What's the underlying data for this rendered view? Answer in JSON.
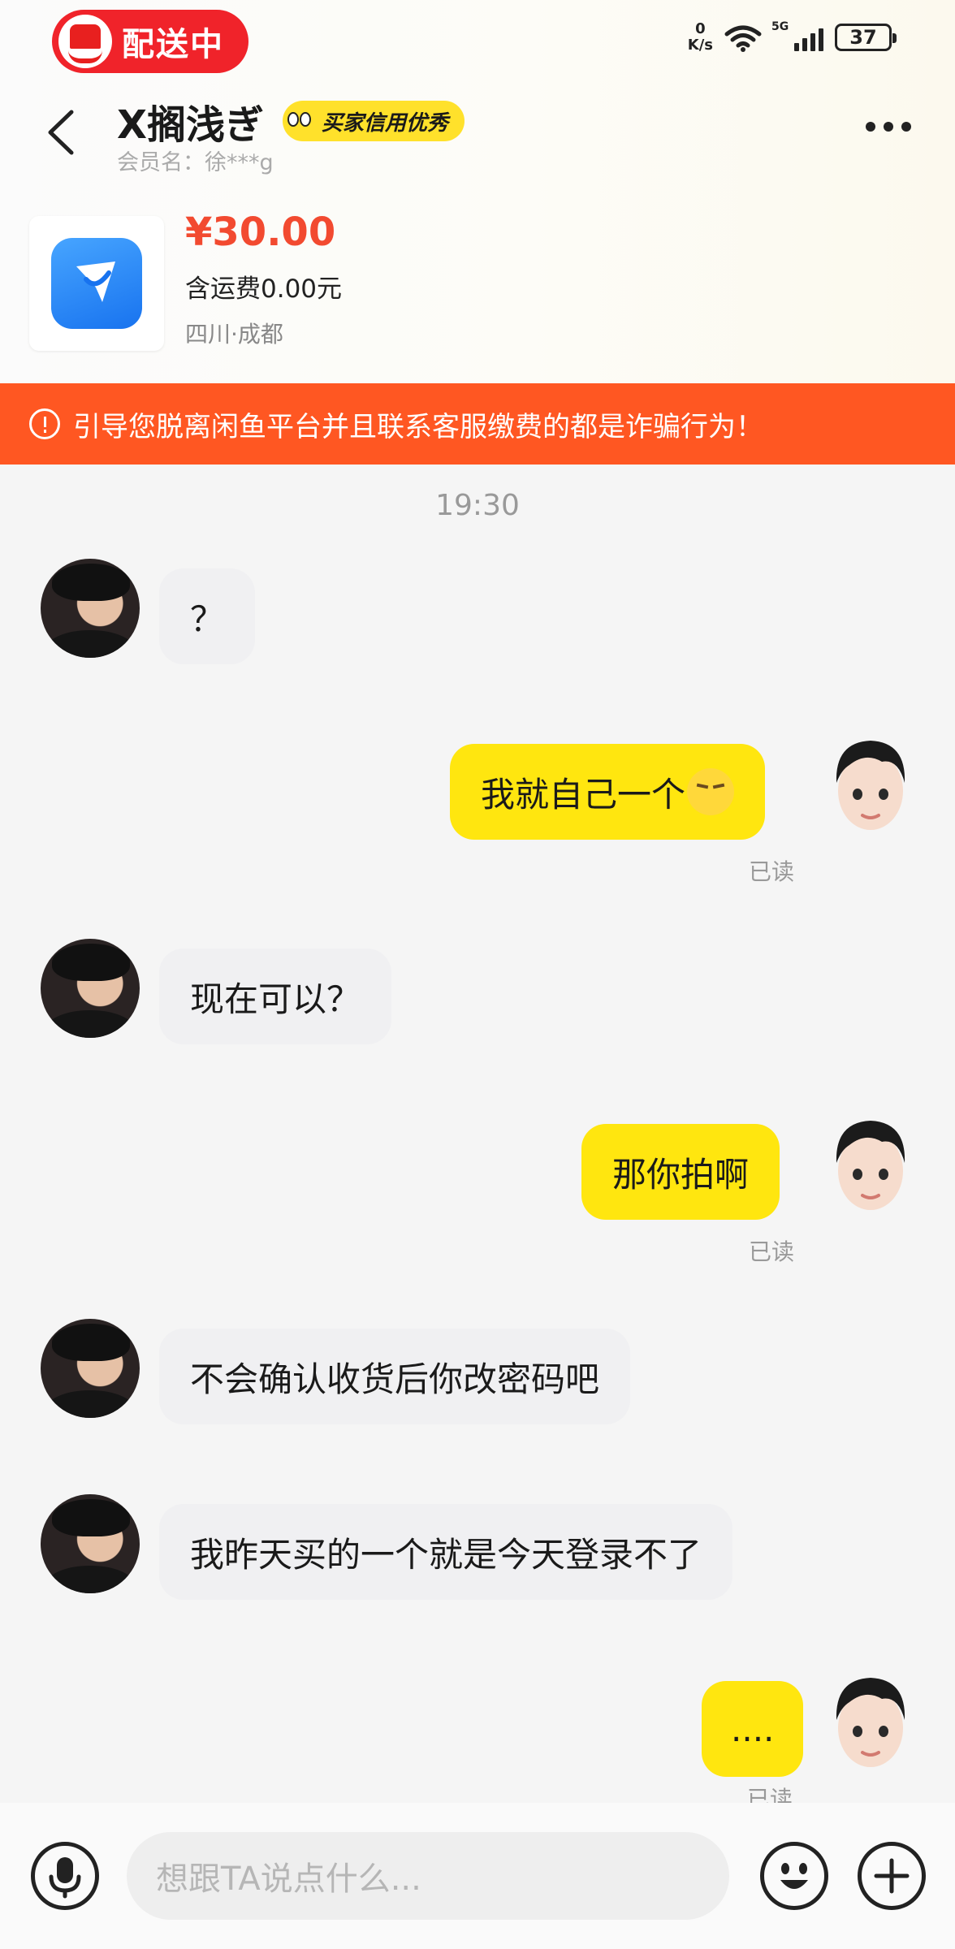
{
  "status_bar": {
    "delivery_label": "配送中",
    "net_speed_value": "0",
    "net_speed_unit": "K/s",
    "network": "5G",
    "battery": "37"
  },
  "header": {
    "title": "X搁浅ぎ",
    "credit_badge": "买家信用优秀",
    "member_name": "会员名：徐***g"
  },
  "product": {
    "price": "¥30.00",
    "shipping": "含运费0.00元",
    "location": "四川·成都"
  },
  "warning": {
    "text": "引导您脱离闲鱼平台并且联系客服缴费的都是诈骗行为！"
  },
  "chat": {
    "timestamp": "19:30",
    "messages": [
      {
        "side": "left",
        "text": "？"
      },
      {
        "side": "right",
        "text": "我就自己一个",
        "emoji": "smirk-emoji",
        "status": "已读"
      },
      {
        "side": "left",
        "text": "现在可以？"
      },
      {
        "side": "right",
        "text": "那你拍啊",
        "status": "已读"
      },
      {
        "side": "left",
        "text": "不会确认收货后你改密码吧"
      },
      {
        "side": "left",
        "text": "我昨天买的一个就是今天登录不了"
      },
      {
        "side": "right",
        "text": "....",
        "status": "已读"
      }
    ]
  },
  "input_bar": {
    "placeholder": "想跟TA说点什么..."
  },
  "colors": {
    "accent_yellow": "#ffe60f",
    "warning_orange": "#ff5722",
    "price_red": "#f24a30",
    "delivery_red": "#f0232a"
  }
}
